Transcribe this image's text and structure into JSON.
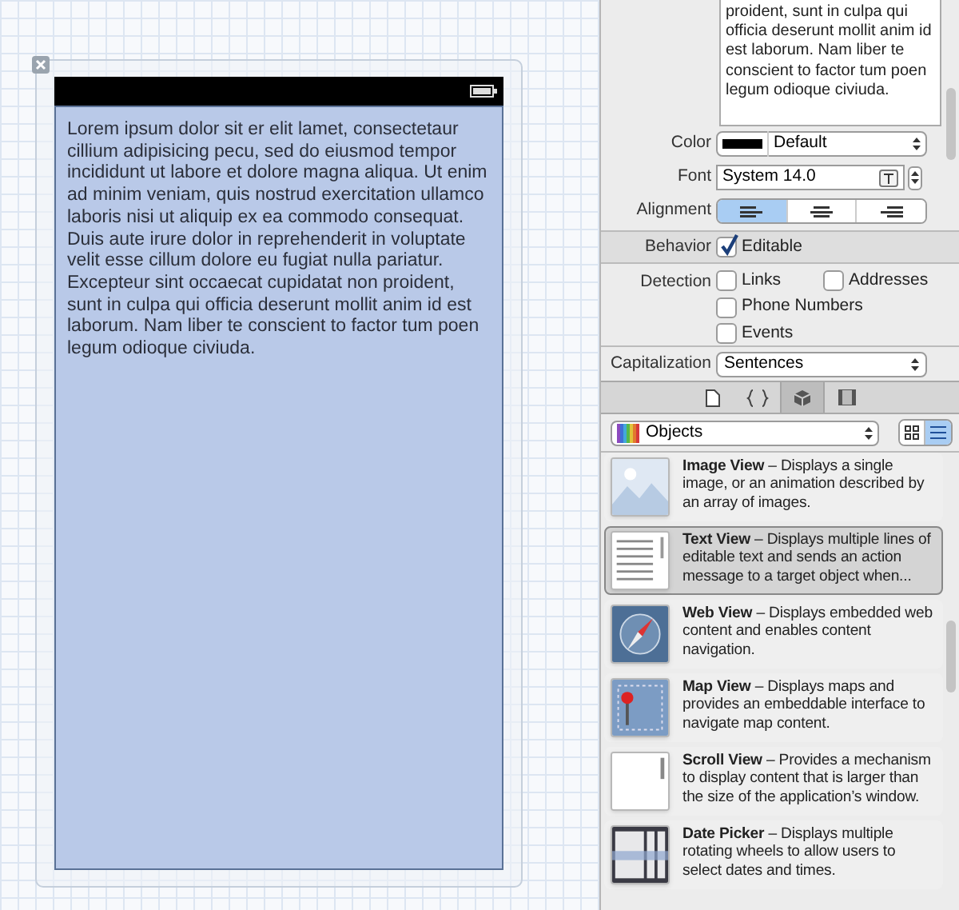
{
  "canvas": {
    "text_view": "Lorem ipsum dolor sit er elit lamet, consectetaur cillium adipisicing pecu, sed do eiusmod tempor incididunt ut labore et dolore magna aliqua. Ut enim ad minim veniam, quis nostrud exercitation ullamco laboris nisi ut aliquip ex ea commodo consequat. Duis aute irure dolor in reprehenderit in voluptate velit esse cillum dolore eu fugiat nulla pariatur. Excepteur sint occaecat cupidatat non proident, sunt in culpa qui officia deserunt mollit anim id est laborum. Nam liber te conscient to factor tum poen legum odioque civiuda."
  },
  "inspector": {
    "text_preview": "proident, sunt in culpa qui officia deserunt mollit anim id est laborum. Nam liber te conscient to factor tum poen legum odioque civiuda.",
    "color": {
      "label": "Color",
      "value": "Default"
    },
    "font": {
      "label": "Font",
      "value": "System 14.0"
    },
    "alignment": {
      "label": "Alignment",
      "segments": [
        {
          "kind": "left",
          "selected": true
        },
        {
          "kind": "center",
          "selected": false
        },
        {
          "kind": "right",
          "selected": false
        }
      ]
    },
    "behavior": {
      "label": "Behavior",
      "option": "Editable",
      "checked": true
    },
    "detection": {
      "label": "Detection",
      "options": [
        {
          "label": "Links",
          "checked": false
        },
        {
          "label": "Addresses",
          "checked": false
        },
        {
          "label": "Phone Numbers",
          "checked": false
        },
        {
          "label": "Events",
          "checked": false
        }
      ]
    },
    "capitalization": {
      "label": "Capitalization",
      "value": "Sentences"
    }
  },
  "library": {
    "tabs": [
      {
        "kind": "file",
        "selected": false
      },
      {
        "kind": "code",
        "selected": false
      },
      {
        "kind": "object",
        "selected": true
      },
      {
        "kind": "media",
        "selected": false
      }
    ],
    "filter": "Objects",
    "view_modes": [
      {
        "kind": "grid",
        "selected": false
      },
      {
        "kind": "list",
        "selected": true
      }
    ],
    "items": [
      {
        "kind": "image",
        "title": "Image View",
        "description": "– Displays a single image, or an animation described by an array of images.",
        "selected": false
      },
      {
        "kind": "text",
        "title": "Text View",
        "description": "– Displays multiple lines of editable text and sends an action message to a target object when...",
        "selected": true
      },
      {
        "kind": "web",
        "title": "Web View",
        "description": "– Displays embedded web content and enables content navigation.",
        "selected": false
      },
      {
        "kind": "map",
        "title": "Map View",
        "description": "– Displays maps and provides an embeddable interface to navigate map content.",
        "selected": false
      },
      {
        "kind": "scroll",
        "title": "Scroll View",
        "description": "– Provides a mechanism to display content that is larger than the size of the application’s window.",
        "selected": false
      },
      {
        "kind": "date",
        "title": "Date Picker",
        "description": "– Displays multiple rotating wheels to allow users to select dates and times.",
        "selected": false
      }
    ]
  }
}
